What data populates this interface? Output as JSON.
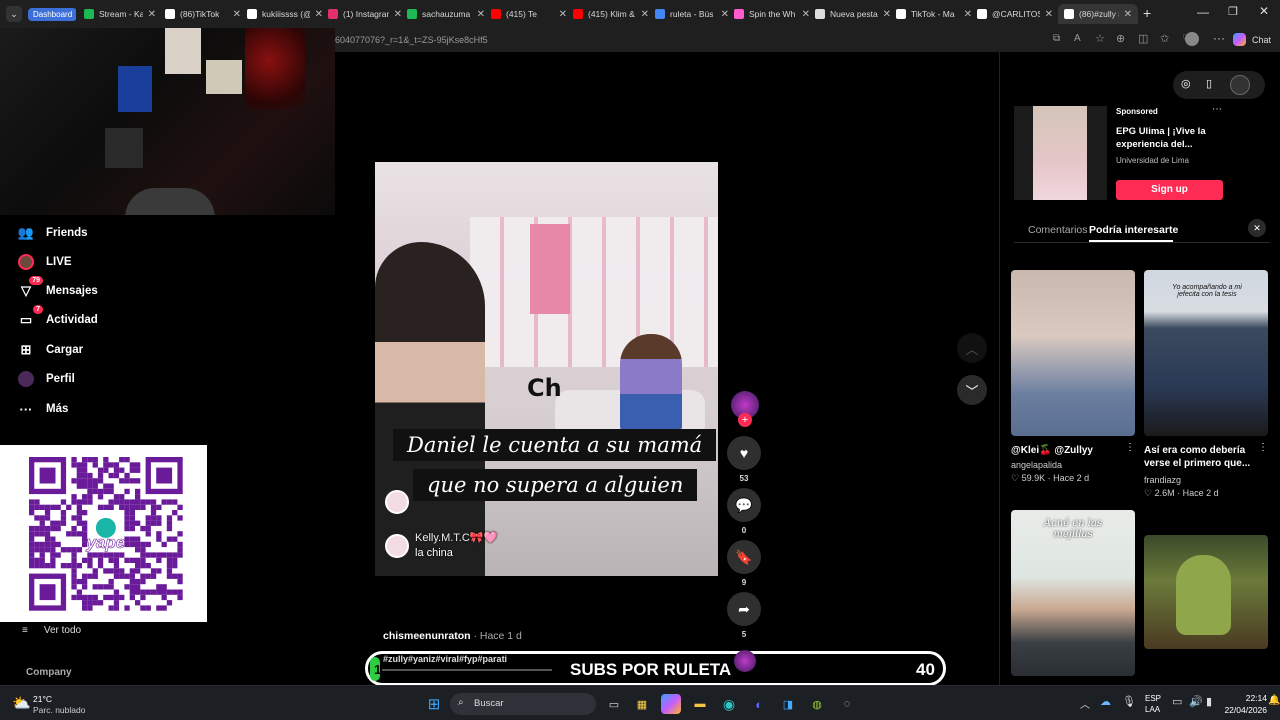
{
  "browser": {
    "tabs": [
      {
        "label": "Dashboard",
        "group": true,
        "color": "#3c6fd8"
      },
      {
        "label": "Stream - Ka",
        "color": "#1db954"
      },
      {
        "label": "(86)TikTok",
        "color": "#ffffff"
      },
      {
        "label": "kukiiissss (@",
        "color": "#ffffff"
      },
      {
        "label": "(1) Instagram",
        "color": "#e1306c"
      },
      {
        "label": "sachauzuma",
        "color": "#1db954"
      },
      {
        "label": "(415) Te",
        "color": "#ff0000"
      },
      {
        "label": "(415) Klim &",
        "color": "#ff0000"
      },
      {
        "label": "ruleta - Bús",
        "color": "#4285f4"
      },
      {
        "label": "Spin the Wh",
        "color": "#ff5ad1"
      },
      {
        "label": "Nueva pesta",
        "color": "#dddddd"
      },
      {
        "label": "TikTok - Ma",
        "color": "#ffffff"
      },
      {
        "label": "@CARLITOS",
        "color": "#ffffff"
      },
      {
        "label": "(86)#zully #",
        "color": "#ffffff",
        "active": true
      }
    ],
    "url": "604077076?_r=1&_t=ZS-95jKse8cHf5",
    "chat_label": "Chat"
  },
  "nav": {
    "items": [
      {
        "label": "Friends",
        "icon": "friends-icon",
        "glyph": "👥"
      },
      {
        "label": "LIVE",
        "icon": "live-icon",
        "glyph": "◉"
      },
      {
        "label": "Mensajes",
        "icon": "messages-icon",
        "glyph": "▽",
        "badge": "79"
      },
      {
        "label": "Actividad",
        "icon": "activity-icon",
        "glyph": "▭",
        "badge": "7"
      },
      {
        "label": "Cargar",
        "icon": "upload-icon",
        "glyph": "⊞"
      },
      {
        "label": "Perfil",
        "icon": "profile-icon",
        "glyph": "●"
      },
      {
        "label": "Más",
        "icon": "more-icon",
        "glyph": "···"
      }
    ],
    "see_all": "Ver todo",
    "company": "Company"
  },
  "qr": {
    "brand": "yape"
  },
  "video": {
    "caption_line1": "Daniel le cuenta a su mamá",
    "caption_line2": "que no supera a alguien",
    "comment_user": "Kelly.M.T.C🎀🩷",
    "comment_text": "la china",
    "watermark": "Ch",
    "author": "chismeenunraton",
    "time": "· Hace 1 d",
    "hashtags": "#zully#yaniz#viral#fyp#parati"
  },
  "actions": {
    "likes": "53",
    "comments": "0",
    "saves": "9",
    "shares": "5"
  },
  "overlay": {
    "label": "SUBS POR RULETA",
    "count": "40",
    "progress_start": "1"
  },
  "right": {
    "ad": {
      "sponsored": "Sponsored",
      "title": "EPG Ulima | ¡Vive la experiencia del...",
      "advertiser": "Universidad de Lima",
      "cta": "Sign up"
    },
    "tabs": [
      "Comentarios",
      "Podría interesarte"
    ],
    "cards": [
      {
        "title": "@Klei🍒 @Zullyy",
        "author": "angelapalida",
        "stats": "♡ 59.9K · Hace 2 d"
      },
      {
        "title": "Así era como debería verse el primero que...",
        "author": "frandiazg",
        "stats": "♡ 2.6M · Hace 2 d",
        "overlay": "Yo acompañando a mi jefecita con la tesis"
      },
      {
        "title": "",
        "author": "",
        "stats": "",
        "overlay": "Acné en las mejillas"
      },
      {
        "title": "",
        "author": "",
        "stats": ""
      }
    ]
  },
  "taskbar": {
    "weather_temp": "21°C",
    "weather_desc": "Parc. nublado",
    "search": "Buscar",
    "lang1": "ESP",
    "lang2": "LAA",
    "time": "22:14",
    "date": "22/04/2026"
  },
  "colors": {
    "accent": "#fe2c55",
    "progress_green": "#2ecc40"
  }
}
